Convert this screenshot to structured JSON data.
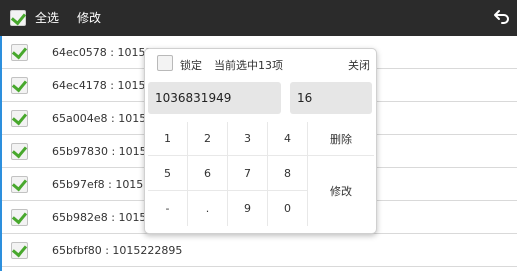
{
  "header": {
    "select_all_label": "全选",
    "edit_label": "修改",
    "back_icon": "back-arrow-icon",
    "background_color": "#2b2b2b",
    "check_color": "#48a82d"
  },
  "list": {
    "items": [
      {
        "text": "64ec0578 : 10152",
        "checked": true
      },
      {
        "text": "64ec4178 : 10152",
        "checked": true
      },
      {
        "text": "65a004e8 : 10152",
        "checked": true
      },
      {
        "text": "65b97830 : 10152",
        "checked": true
      },
      {
        "text": "65b97ef8 : 10152",
        "checked": true
      },
      {
        "text": "65b982e8 : 10152",
        "checked": true
      },
      {
        "text": "65bfbf80 : 1015222895",
        "checked": true
      }
    ]
  },
  "dialog": {
    "lock_label": "锁定",
    "lock_checked": false,
    "selection_text": "当前选中13项",
    "close_label": "关闭",
    "value_field": "1036831949",
    "size_field": "16",
    "keys": {
      "k1": "1",
      "k2": "2",
      "k3": "3",
      "k4": "4",
      "k5": "5",
      "k6": "6",
      "k7": "7",
      "k8": "8",
      "kminus": "-",
      "kdot": ".",
      "k9": "9",
      "k0": "0",
      "delete": "删除",
      "modify": "修改"
    }
  }
}
